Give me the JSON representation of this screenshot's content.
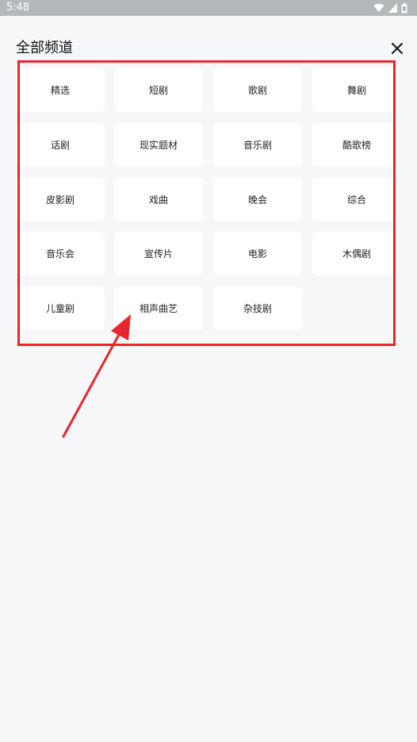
{
  "status_bar": {
    "time": "5:48",
    "icons": [
      "wifi-icon",
      "signal-icon",
      "battery-icon"
    ]
  },
  "header": {
    "title": "全部频道",
    "close_icon": "close-icon"
  },
  "channels": [
    "精选",
    "短剧",
    "歌剧",
    "舞剧",
    "话剧",
    "现实题材",
    "音乐剧",
    "酷歌榜",
    "皮影剧",
    "戏曲",
    "晚会",
    "综合",
    "音乐会",
    "宣传片",
    "电影",
    "木偶剧",
    "儿童剧",
    "相声曲艺",
    "杂技剧"
  ],
  "colors": {
    "background": "#f5f7f8",
    "status_bar": "#b5b8ba",
    "tile": "#ffffff",
    "annotation": "#e8262d"
  }
}
